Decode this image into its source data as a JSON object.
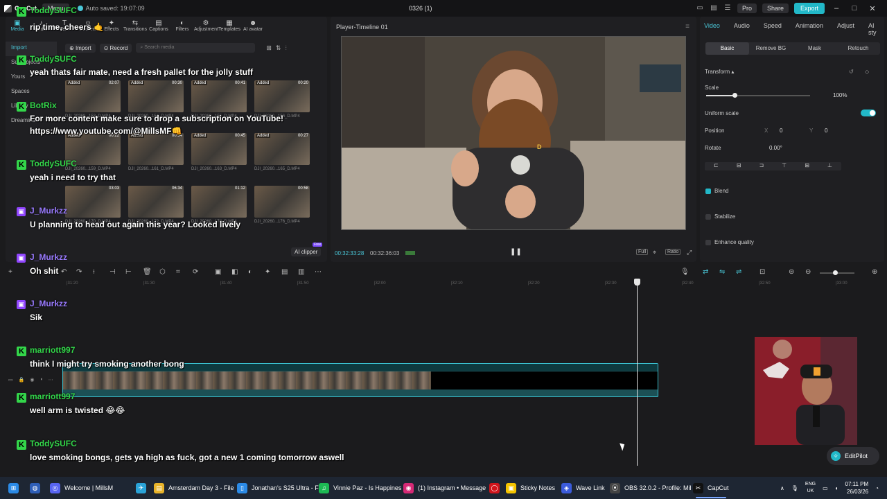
{
  "titlebar": {
    "app_name": "CapCut",
    "menu_label": "Menu",
    "autosave": "Auto saved: 19:07:09",
    "project_name": "0326 (1)",
    "pro_label": "Pro",
    "share_label": "Share",
    "export_label": "Export"
  },
  "media_tabs": [
    "Media",
    "Audio",
    "Text",
    "Stickers",
    "Effects",
    "Transitions",
    "Captions",
    "Filters",
    "Adjustment",
    "Templates",
    "AI avatar"
  ],
  "media_side": [
    "Import",
    "Subprojects",
    "Yours",
    "Spaces",
    "Library",
    "Dreamina"
  ],
  "media_toolbar": {
    "import_label": "Import",
    "record_label": "Record",
    "search_placeholder": "Search media"
  },
  "thumbs": [
    {
      "added": "Added",
      "dur": "02:07",
      "name": "DJI_20260...153_D.MP4"
    },
    {
      "added": "Added",
      "dur": "00:30",
      "name": "DJI_20260...154_D.MP4"
    },
    {
      "added": "Added",
      "dur": "00:41",
      "name": "DJI_20260...155_D.MP4"
    },
    {
      "added": "Added",
      "dur": "00:20",
      "name": "DJI_20260...156_D.MP4"
    },
    {
      "added": "Added",
      "dur": "00:22",
      "name": "DJI_20260...159_D.MP4"
    },
    {
      "added": "Added",
      "dur": "00:34",
      "name": "DJI_20260...161_D.MP4"
    },
    {
      "added": "Added",
      "dur": "00:45",
      "name": "DJI_20260...163_D.MP4"
    },
    {
      "added": "Added",
      "dur": "00:27",
      "name": "DJI_20260...165_D.MP4"
    },
    {
      "added": "",
      "dur": "03:03",
      "name": "DJI_20260...170_D.MP4"
    },
    {
      "added": "",
      "dur": "06:34",
      "name": "DJI_20260...172_D.MP4"
    },
    {
      "added": "",
      "dur": "01:12",
      "name": "DJI_20260...174_D.MP4"
    },
    {
      "added": "",
      "dur": "00:58",
      "name": "DJI_20260...176_D.MP4"
    }
  ],
  "ai_clipper": {
    "label": "AI clipper",
    "badge": "Free"
  },
  "player": {
    "title": "Player-Timeline 01",
    "current_time": "00:32:33:28",
    "total_time": "00:32:36:03",
    "full_label": "Full",
    "ratio_label": "Ratio"
  },
  "inspector": {
    "tabs": [
      "Video",
      "Audio",
      "Speed",
      "Animation",
      "Adjust",
      "AI sty"
    ],
    "subtabs": [
      "Basic",
      "Remove BG",
      "Mask",
      "Retouch"
    ],
    "transform_label": "Transform",
    "scale_label": "Scale",
    "scale_value": "100%",
    "scale_level": 0.1,
    "uniform_label": "Uniform scale",
    "position_label": "Position",
    "pos_x_label": "X",
    "pos_x": "0",
    "pos_y_label": "Y",
    "pos_y": "0",
    "rotate_label": "Rotate",
    "rotate_value": "0.00°",
    "blend_label": "Blend",
    "stabilize_label": "Stabilize",
    "enhance_label": "Enhance quality"
  },
  "ruler_ticks": [
    "|31:20",
    "|31:30",
    "|31:40",
    "|31:50",
    "|32:00",
    "|32:10",
    "|32:20",
    "|32:30",
    "|32:40",
    "|32:50",
    "|33:00"
  ],
  "chat": [
    {
      "platform": "kick",
      "user": "ToddySUFC",
      "msg": "rip time, cheers 🤙"
    },
    {
      "platform": "kick",
      "user": "ToddySUFC",
      "msg": "yeah thats fair mate, need a fresh pallet for the jolly stuff"
    },
    {
      "platform": "kick",
      "user": "BotRix",
      "msg": "For more content make sure to drop a subscription on YouTube!"
    },
    {
      "platform": "none",
      "user": "",
      "msg": "https://www.youtube.com/@MillsMF👊"
    },
    {
      "platform": "kick",
      "user": "ToddySUFC",
      "msg": "yeah i need to try that"
    },
    {
      "platform": "twitch",
      "user": "J_Murkzz",
      "msg": "U planning to head out again this year? Looked lively"
    },
    {
      "platform": "twitch",
      "user": "J_Murkzz",
      "msg": "Oh shit"
    },
    {
      "platform": "twitch",
      "user": "J_Murkzz",
      "msg": "Sik"
    },
    {
      "platform": "kick",
      "user": "marriott997",
      "msg": "think I might try smoking another bong"
    },
    {
      "platform": "kick",
      "user": "marriott997",
      "msg": "well arm is twisted 😂😂"
    },
    {
      "platform": "kick",
      "user": "ToddySUFC",
      "msg": "love smoking bongs, gets ya high as fuck, got a new 1 coming tomorrow aswell"
    }
  ],
  "editpilot_label": "EditPilot",
  "taskbar": {
    "items": [
      "Welcome | MillsM",
      "Amsterdam Day 3 - File",
      "Jonathan's S25 Ultra - F",
      "Vinnie Paz - Is Happines",
      "(1) Instagram • Message",
      "Sticky Notes",
      "Wave Link",
      "OBS 32.0.2 - Profile: Mil",
      "CapCut"
    ],
    "lang_top": "ENG",
    "lang_bottom": "UK",
    "time": "07:11 PM",
    "date": "26/03/26"
  },
  "colors": {
    "accent": "#22b8c8",
    "kick": "#33d64a",
    "twitch": "#9146ff"
  }
}
